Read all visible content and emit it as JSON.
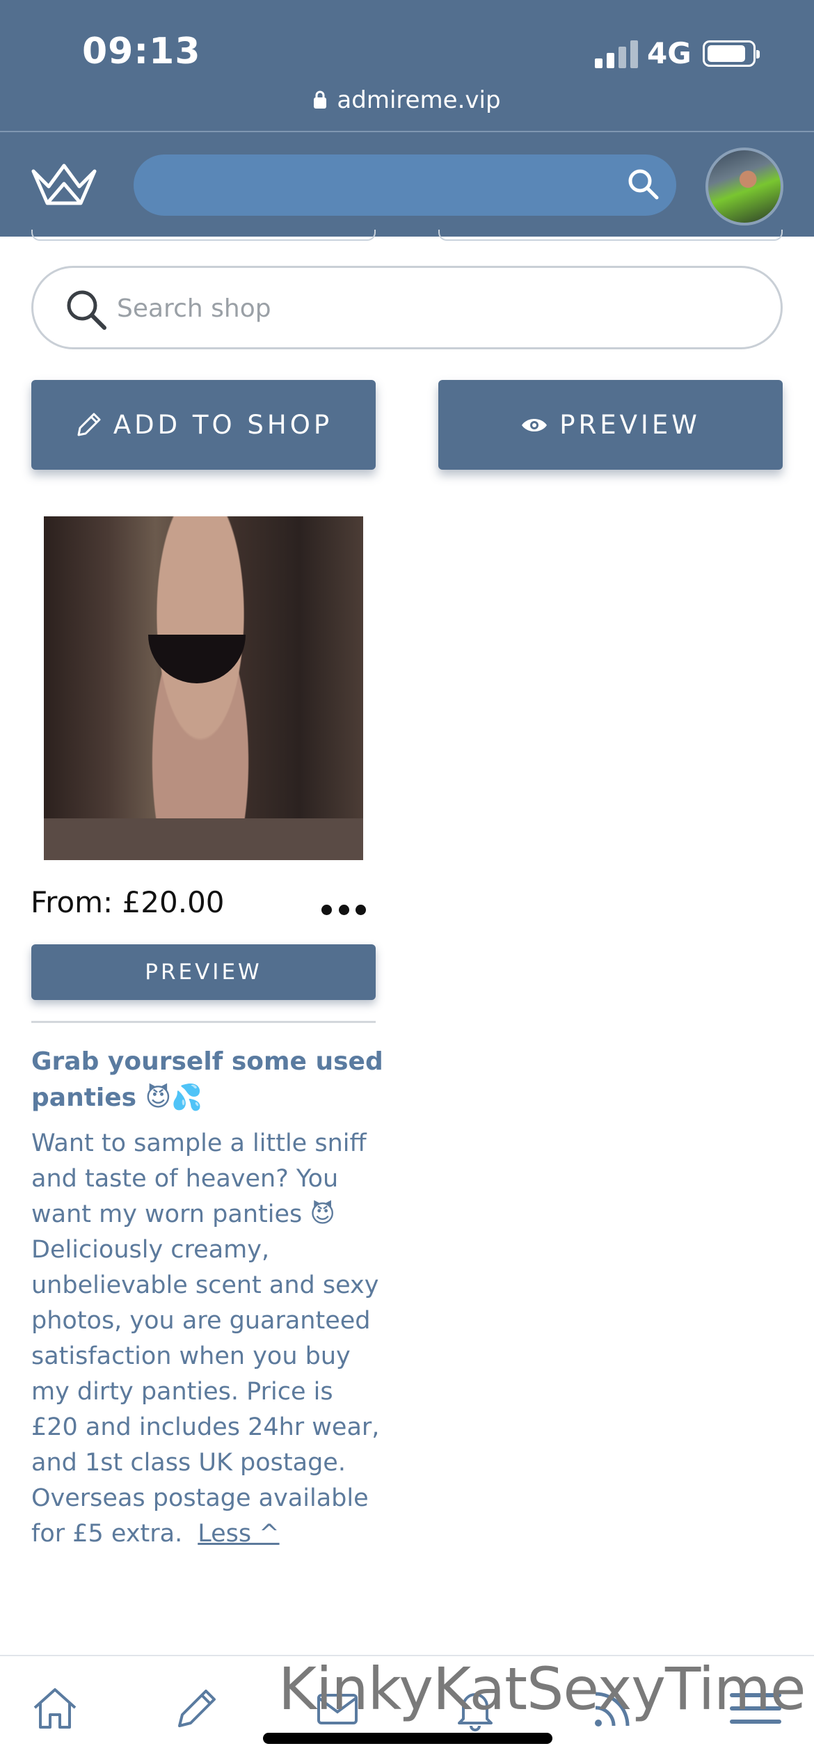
{
  "status_bar": {
    "time": "09:13",
    "network": "4G",
    "url": "admireme.vip",
    "icons": [
      "signal-icon",
      "battery-icon",
      "lock-icon"
    ]
  },
  "header": {
    "logo": "crown-logo-icon",
    "search_icon": "search-icon",
    "avatar": "profile-avatar"
  },
  "shop": {
    "search_placeholder": "Search shop",
    "add_to_shop_label": "ADD TO SHOP",
    "preview_label": "PREVIEW"
  },
  "product": {
    "price": "From: £20.00",
    "preview_label": "PREVIEW",
    "title": "Grab yourself some used panties 😈💦",
    "description": "Want to sample a little sniff and taste of heaven? You want my worn panties 😈 Deliciously creamy, unbelievable scent and sexy photos, you are guaranteed satisfaction when you buy my dirty panties. Price is £20 and includes 24hr wear, and 1st class UK postage. Overseas postage available for £5 extra.",
    "less_label": "Less ^"
  },
  "bottom_nav": {
    "items": [
      "home-icon",
      "pencil-icon",
      "mail-icon",
      "bell-icon",
      "feed-icon",
      "menu-icon"
    ]
  },
  "watermark": "KinkyKatSexyTime",
  "colors": {
    "header_bg": "#536f8f",
    "search_bg": "#5a87b7",
    "button_bg": "#536f8f",
    "text_accent": "#5a7ba0"
  }
}
